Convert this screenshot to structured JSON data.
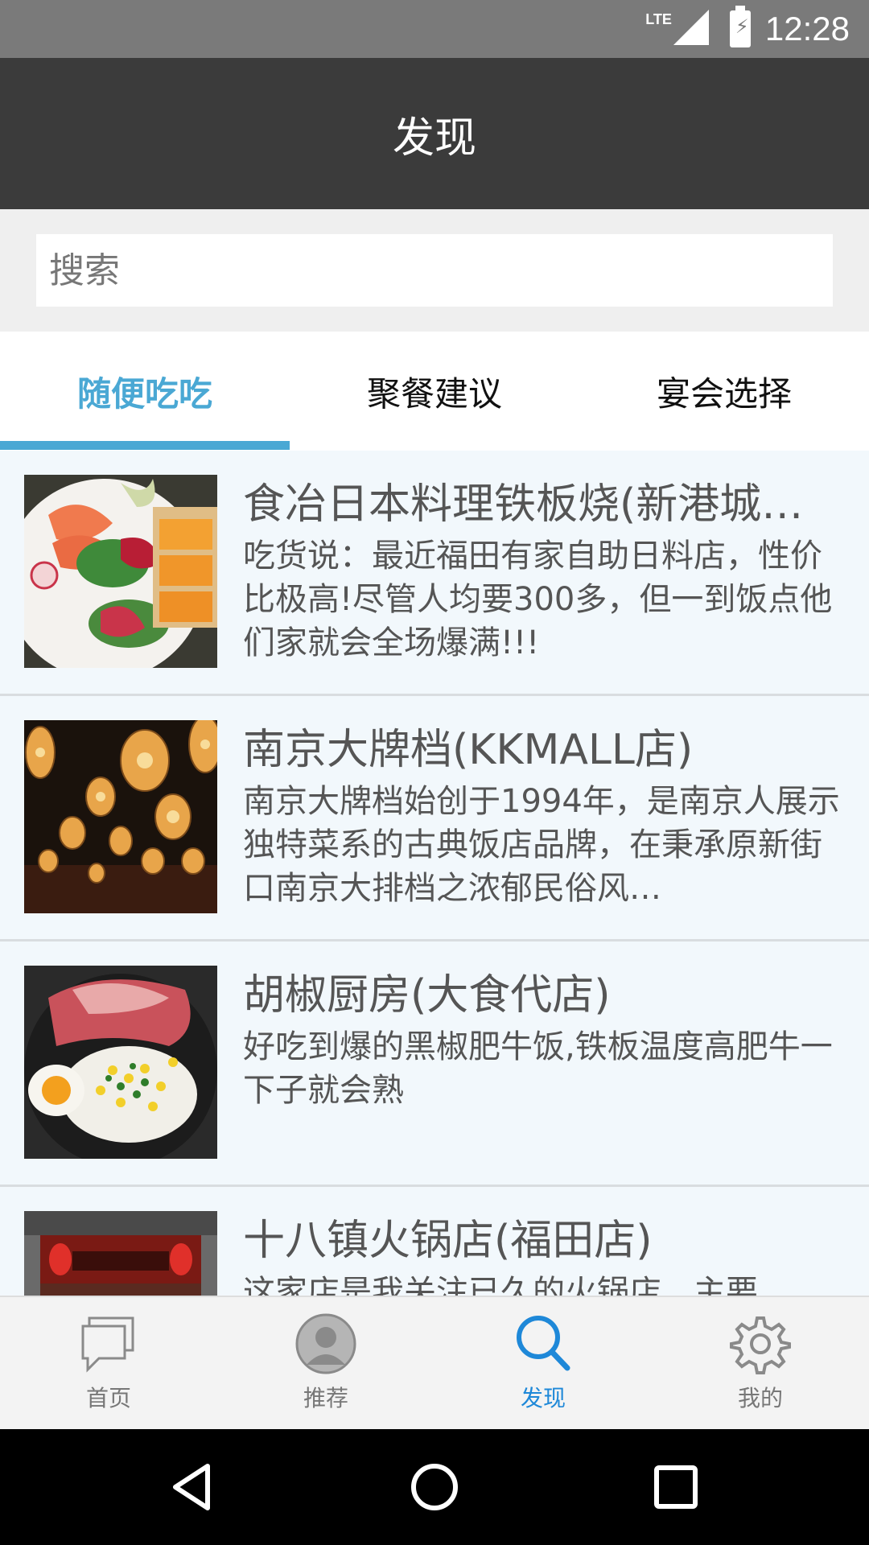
{
  "status_bar": {
    "network": "LTE",
    "time": "12:28"
  },
  "app_bar": {
    "title": "发现"
  },
  "search": {
    "placeholder": "搜索"
  },
  "tabs": [
    {
      "label": "随便吃吃",
      "active": true
    },
    {
      "label": "聚餐建议",
      "active": false
    },
    {
      "label": "宴会选择",
      "active": false
    }
  ],
  "restaurants": [
    {
      "name": "食冶日本料理铁板烧(新港城…",
      "description": "吃货说：最近福田有家自助日料店，性价比极高!尽管人均要300多，但一到饭点他们家就会全场爆满!!!",
      "image": "sashimi-platter"
    },
    {
      "name": "南京大牌档(KKMALL店)",
      "description": "南京大牌档始创于1994年，是南京人展示独特菜系的古典饭店品牌，在秉承原新街口南京大排档之浓郁民俗风…",
      "image": "lantern-dining-room"
    },
    {
      "name": "胡椒厨房(大食代店)",
      "description": "好吃到爆的黑椒肥牛饭,铁板温度高肥牛一下子就会熟",
      "image": "pepper-beef-rice"
    },
    {
      "name": "十八镇火锅店(福田店)",
      "description": "这家店是我关注已久的火锅店，主要",
      "image": "hotpot-storefront"
    }
  ],
  "bottom_nav": [
    {
      "label": "首页",
      "icon": "chat-bubble-icon",
      "active": false
    },
    {
      "label": "推荐",
      "icon": "person-icon",
      "active": false
    },
    {
      "label": "发现",
      "icon": "search-icon",
      "active": true
    },
    {
      "label": "我的",
      "icon": "gear-icon",
      "active": false
    }
  ],
  "colors": {
    "accent": "#4aa8d4",
    "nav_active": "#1e88d8",
    "app_bar": "#3b3b3b"
  }
}
